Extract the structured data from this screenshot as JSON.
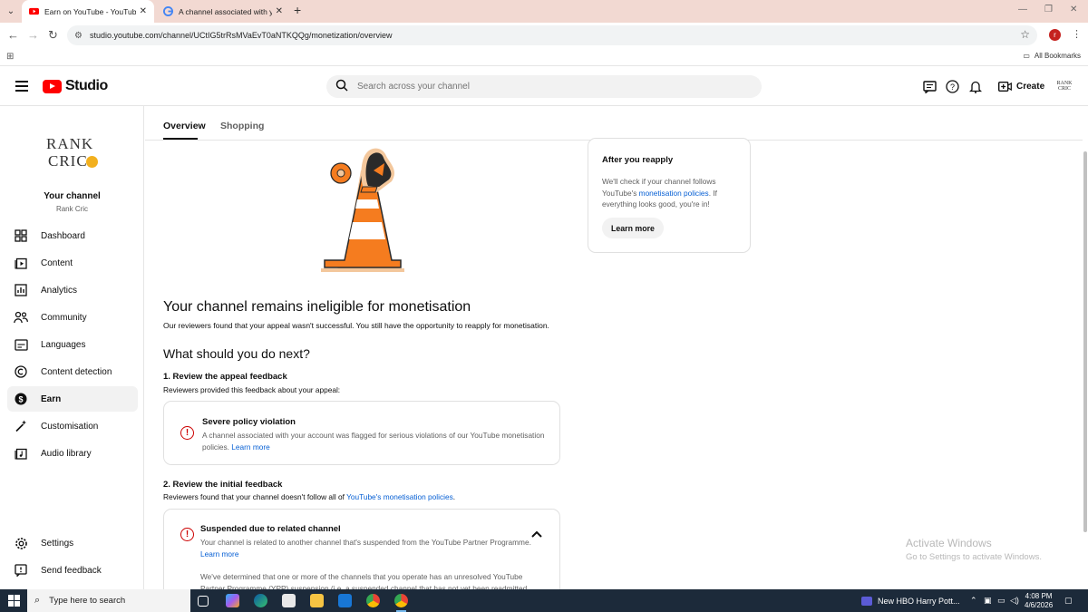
{
  "browser": {
    "tabs": [
      {
        "title": "Earn on YouTube - YouTube Stu",
        "active": true,
        "favicon": "youtube-icon"
      },
      {
        "title": "A channel associated with your",
        "active": false,
        "favicon": "google-icon"
      }
    ],
    "url": "studio.youtube.com/channel/UCtIG5trRsMVaEvT0aNTKQQg/monetization/overview",
    "profile_initial": "r",
    "bookmarks_label": "All Bookmarks"
  },
  "header": {
    "logo_text": "Studio",
    "search_placeholder": "Search across your channel",
    "create_label": "Create",
    "avatar_text": "RANK CRIC"
  },
  "sidebar": {
    "channel_logo_line1": "RANK",
    "channel_logo_line2": "CRIC",
    "your_channel": "Your channel",
    "channel_name": "Rank Cric",
    "items": [
      {
        "label": "Dashboard",
        "icon": "dashboard-icon"
      },
      {
        "label": "Content",
        "icon": "content-icon"
      },
      {
        "label": "Analytics",
        "icon": "analytics-icon"
      },
      {
        "label": "Community",
        "icon": "community-icon"
      },
      {
        "label": "Languages",
        "icon": "languages-icon"
      },
      {
        "label": "Content detection",
        "icon": "copyright-icon"
      },
      {
        "label": "Earn",
        "icon": "dollar-icon",
        "active": true
      },
      {
        "label": "Customisation",
        "icon": "wand-icon"
      },
      {
        "label": "Audio library",
        "icon": "audio-library-icon"
      }
    ],
    "settings_label": "Settings",
    "feedback_label": "Send feedback"
  },
  "main": {
    "tabs": [
      "Overview",
      "Shopping"
    ],
    "heading": "Your channel remains ineligible for monetisation",
    "subtext": "Our reviewers found that your appeal wasn't successful. You still have the opportunity to reapply for monetisation.",
    "next_heading": "What should you do next?",
    "step1": {
      "title": "1. Review the appeal feedback",
      "desc": "Reviewers provided this feedback about your appeal:",
      "card_title": "Severe policy violation",
      "card_body": "A channel associated with your account was flagged for serious violations of our YouTube monetisation policies.",
      "card_link": "Learn more"
    },
    "step2": {
      "title": "2. Review the initial feedback",
      "desc_prefix": "Reviewers found that your channel doesn't follow all of ",
      "desc_link": "YouTube's monetisation policies",
      "desc_suffix": ".",
      "card_title": "Suspended due to related channel",
      "card_body": "Your channel is related to another channel that's suspended from the YouTube Partner Programme.",
      "card_link": "Learn more",
      "card_more": "We've determined that one or more of the channels that you operate has an unresolved YouTube Partner Programme (YPP) suspension (i.e. a suspended channel that has not yet been readmitted"
    },
    "reapply_card": {
      "title": "After you reapply",
      "body_prefix": "We'll check if your channel follows YouTube's ",
      "body_link": "monetisation policies",
      "body_suffix": ". If everything looks good, you're in!",
      "button": "Learn more"
    }
  },
  "activate": {
    "line1": "Activate Windows",
    "line2": "Go to Settings to activate Windows."
  },
  "taskbar": {
    "search_placeholder": "Type here to search",
    "news": "New HBO Harry Pott...",
    "time": "4:08 PM",
    "date": "4/6/2026"
  }
}
